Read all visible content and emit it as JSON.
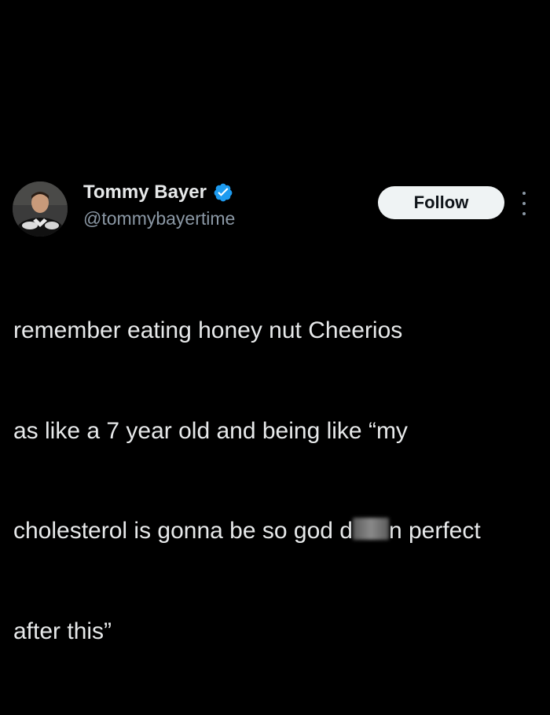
{
  "author": {
    "name": "Tommy Bayer",
    "handle": "@tommybayertime",
    "verified": true,
    "avatar_icon": "profile-photo"
  },
  "actions": {
    "follow_label": "Follow",
    "more_icon": "more-vertical-icon"
  },
  "tweet": {
    "line1": "remember eating honey nut  Cheerios",
    "line2": "as like a 7 year old and being like “my",
    "line3_before": "cholesterol is gonna be so god d",
    "line3_censored": "amm",
    "line3_after": "n perfect",
    "line4": "after this”"
  },
  "colors": {
    "background": "#000000",
    "text": "#e7e9ea",
    "secondary_text": "#8b98a5",
    "verified_badge": "#1d9bf0",
    "follow_button_bg": "#eff3f4",
    "follow_button_text": "#0f1419"
  }
}
